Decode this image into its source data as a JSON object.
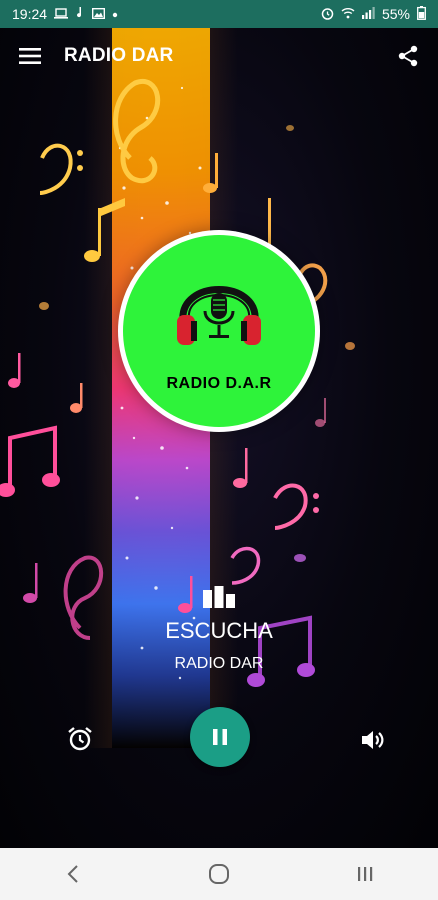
{
  "status_bar": {
    "time": "19:24",
    "battery": "55%",
    "left_icons": [
      "laptop-icon",
      "music-note-icon",
      "image-icon",
      "dot-icon"
    ],
    "right_icons": [
      "alarm-icon",
      "wifi-icon",
      "signal-icon",
      "battery-icon"
    ]
  },
  "app_bar": {
    "title": "RADIO DAR",
    "menu_icon": "hamburger-menu-icon",
    "share_icon": "share-icon"
  },
  "logo": {
    "text": "RADIO D.A.R",
    "background": "#2ef33a"
  },
  "now_playing": {
    "title": "ESCUCHA",
    "subtitle": "RADIO DAR"
  },
  "controls": {
    "alarm_icon": "alarm-clock-icon",
    "pause_icon": "pause-icon",
    "volume_icon": "volume-icon",
    "accent": "#1b9e86"
  },
  "nav_bar": {
    "back_icon": "back-icon",
    "home_icon": "home-icon",
    "recents_icon": "recents-icon"
  },
  "colors": {
    "status_bar": "#1d6e5f",
    "nav_bar": "#f4f4f4"
  }
}
